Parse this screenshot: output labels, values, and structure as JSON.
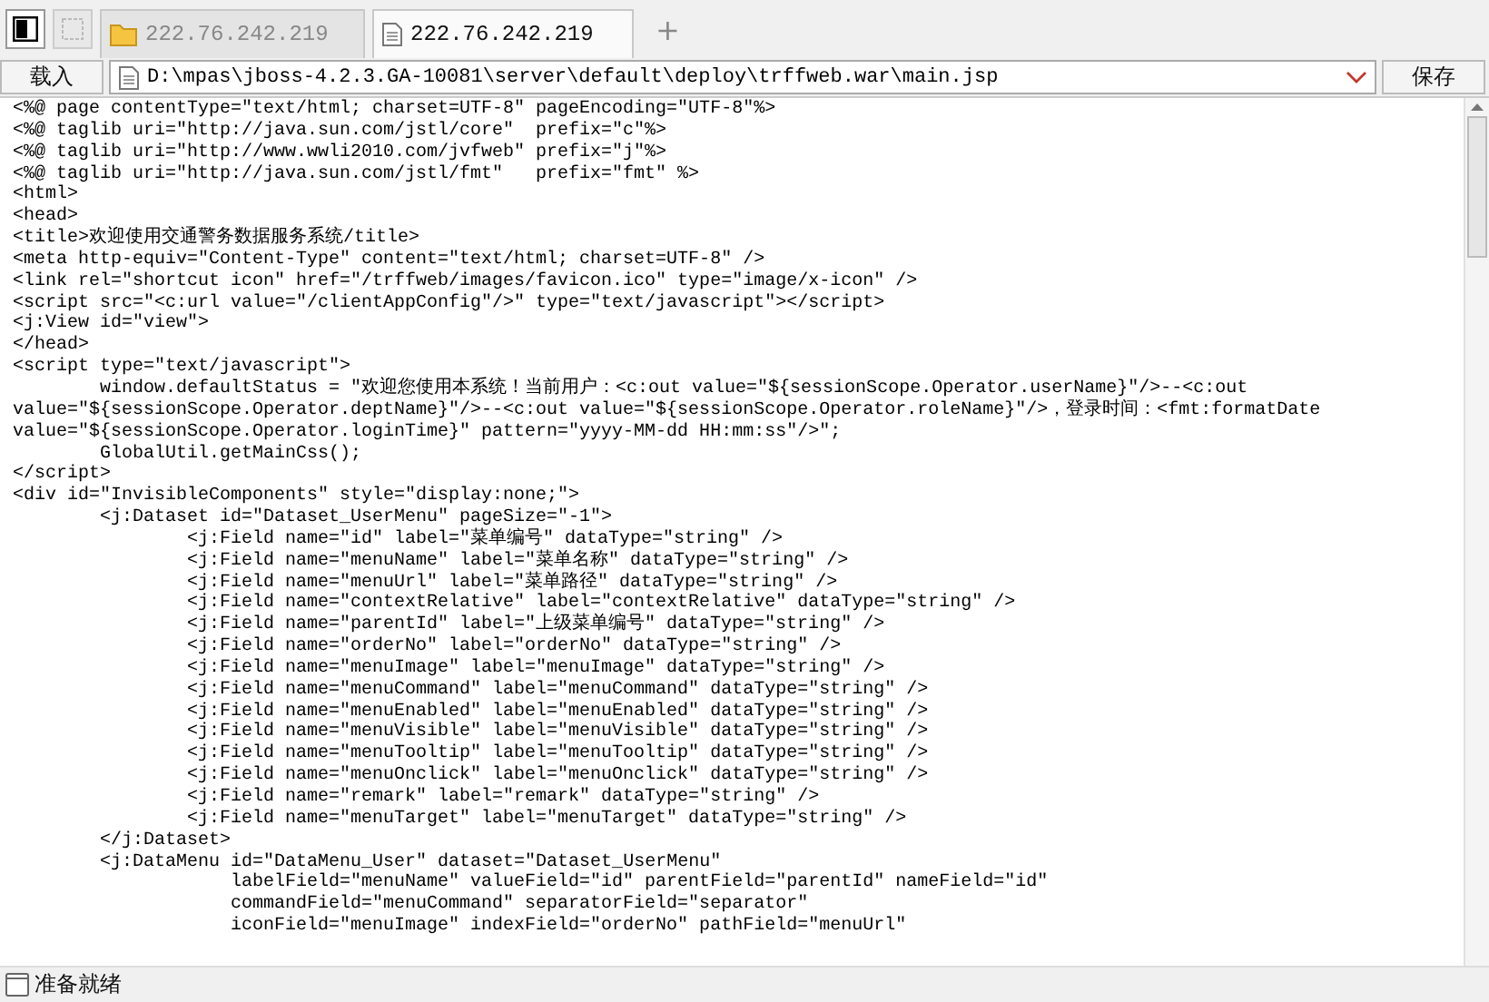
{
  "tabs": [
    {
      "kind": "folder",
      "label": "222.76.242.219",
      "selected": false
    },
    {
      "kind": "document",
      "label": "222.76.242.219",
      "selected": true
    }
  ],
  "new_tab": "+",
  "address_bar": {
    "load_button": "载入",
    "path": "D:\\mpas\\jboss-4.2.3.GA-10081\\server\\default\\deploy\\trffweb.war\\main.jsp",
    "save_button": "保存"
  },
  "code_lines": [
    "<%@ page contentType=\"text/html; charset=UTF-8\" pageEncoding=\"UTF-8\"%>",
    "<%@ taglib uri=\"http://java.sun.com/jstl/core\"  prefix=\"c\"%>",
    "<%@ taglib uri=\"http://www.wwli2010.com/jvfweb\" prefix=\"j\"%>",
    "<%@ taglib uri=\"http://java.sun.com/jstl/fmt\"   prefix=\"fmt\" %>",
    "<html>",
    "<head>",
    "<title>欢迎使用交通警务数据服务系统/title>",
    "<meta http-equiv=\"Content-Type\" content=\"text/html; charset=UTF-8\" />",
    "<link rel=\"shortcut icon\" href=\"/trffweb/images/favicon.ico\" type=\"image/x-icon\" />",
    "<script src=\"<c:url value=\"/clientAppConfig\"/>\" type=\"text/javascript\"></script>",
    "<j:View id=\"view\">",
    "</head>",
    "<script type=\"text/javascript\">",
    "\twindow.defaultStatus = \"欢迎您使用本系统！当前用户：<c:out value=\"${sessionScope.Operator.userName}\"/>--<c:out",
    "value=\"${sessionScope.Operator.deptName}\"/>--<c:out value=\"${sessionScope.Operator.roleName}\"/>，登录时间：<fmt:formatDate",
    "value=\"${sessionScope.Operator.loginTime}\" pattern=\"yyyy-MM-dd HH:mm:ss\"/>\";",
    "\tGlobalUtil.getMainCss();",
    "</script>",
    "<div id=\"InvisibleComponents\" style=\"display:none;\">",
    "\t<j:Dataset id=\"Dataset_UserMenu\" pageSize=\"-1\">",
    "\t\t<j:Field name=\"id\" label=\"菜单编号\" dataType=\"string\" />",
    "\t\t<j:Field name=\"menuName\" label=\"菜单名称\" dataType=\"string\" />",
    "\t\t<j:Field name=\"menuUrl\" label=\"菜单路径\" dataType=\"string\" />",
    "\t\t<j:Field name=\"contextRelative\" label=\"contextRelative\" dataType=\"string\" />",
    "\t\t<j:Field name=\"parentId\" label=\"上级菜单编号\" dataType=\"string\" />",
    "\t\t<j:Field name=\"orderNo\" label=\"orderNo\" dataType=\"string\" />",
    "\t\t<j:Field name=\"menuImage\" label=\"menuImage\" dataType=\"string\" />",
    "\t\t<j:Field name=\"menuCommand\" label=\"menuCommand\" dataType=\"string\" />",
    "\t\t<j:Field name=\"menuEnabled\" label=\"menuEnabled\" dataType=\"string\" />",
    "\t\t<j:Field name=\"menuVisible\" label=\"menuVisible\" dataType=\"string\" />",
    "\t\t<j:Field name=\"menuTooltip\" label=\"menuTooltip\" dataType=\"string\" />",
    "\t\t<j:Field name=\"menuOnclick\" label=\"menuOnclick\" dataType=\"string\" />",
    "\t\t<j:Field name=\"remark\" label=\"remark\" dataType=\"string\" />",
    "\t\t<j:Field name=\"menuTarget\" label=\"menuTarget\" dataType=\"string\" />",
    "\t</j:Dataset>",
    "\t<j:DataMenu id=\"DataMenu_User\" dataset=\"Dataset_UserMenu\"",
    "\t\t    labelField=\"menuName\" valueField=\"id\" parentField=\"parentId\" nameField=\"id\"",
    "\t\t    commandField=\"menuCommand\" separatorField=\"separator\"",
    "\t\t    iconField=\"menuImage\" indexField=\"orderNo\" pathField=\"menuUrl\""
  ],
  "status_bar": "准备就绪"
}
